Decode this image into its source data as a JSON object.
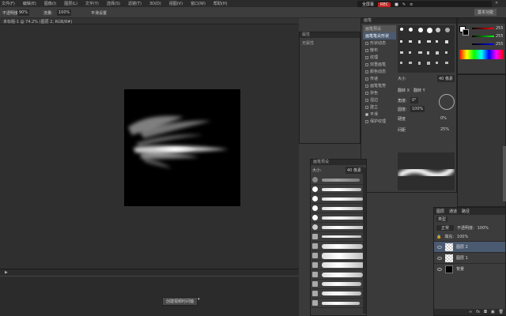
{
  "menu": [
    "文件(F)",
    "编辑(E)",
    "图像(I)",
    "图层(L)",
    "文字(Y)",
    "选择(S)",
    "滤镜(T)",
    "3D(D)",
    "视图(V)",
    "窗口(W)",
    "帮助(H)"
  ],
  "recorder": {
    "label": "全屏幕",
    "rec": "REC"
  },
  "workspace_label": "基本功能",
  "options": {
    "opacity_label": "不透明度:",
    "opacity": "90%",
    "flow_label": "流量:",
    "flow": "100%",
    "smooth_label": "平滑设置"
  },
  "doc_tab": "未标题-1 @ 74.2% (图层 2, RGB/8#)",
  "attributes_panel": {
    "title": "属性",
    "content": "无属性"
  },
  "brush_panel": {
    "title": "画笔",
    "preset_button": "画笔预设",
    "tip_shape": "画笔笔尖形状",
    "options": [
      "形状动态",
      "散布",
      "纹理",
      "双重画笔",
      "颜色动态",
      "传递",
      "画笔笔势",
      "杂色",
      "湿边",
      "建立",
      "平滑",
      "保护纹理"
    ],
    "size_label": "大小",
    "size_value": "40 像素",
    "flip_x": "翻转 X",
    "flip_y": "翻转 Y",
    "angle_label": "角度:",
    "angle": "0°",
    "roundness_label": "圆度:",
    "roundness": "100%",
    "hardness_label": "硬度",
    "hardness": "0%",
    "spacing_label": "间距",
    "spacing": "25%"
  },
  "brush_presets_panel": {
    "title": "画笔预设",
    "size_label": "大小:",
    "size_value": "40 像素"
  },
  "color": {
    "r": "255",
    "g": "255",
    "b": "255"
  },
  "layers": {
    "tabs": [
      "图层",
      "通道",
      "路径"
    ],
    "kind_label": "类型",
    "mode": "正常",
    "opacity_label": "不透明度:",
    "opacity": "100%",
    "fill_label": "填充:",
    "fill": "100%",
    "items": [
      {
        "name": "图层 2"
      },
      {
        "name": "图层 1"
      },
      {
        "name": "背景"
      }
    ]
  },
  "timeline_button": "创建视频时间轴",
  "colors": {
    "bg": "#3a3a3a",
    "panel": "#3c3c3c",
    "rec": "#c61f1f",
    "selection": "#4a5a70"
  }
}
